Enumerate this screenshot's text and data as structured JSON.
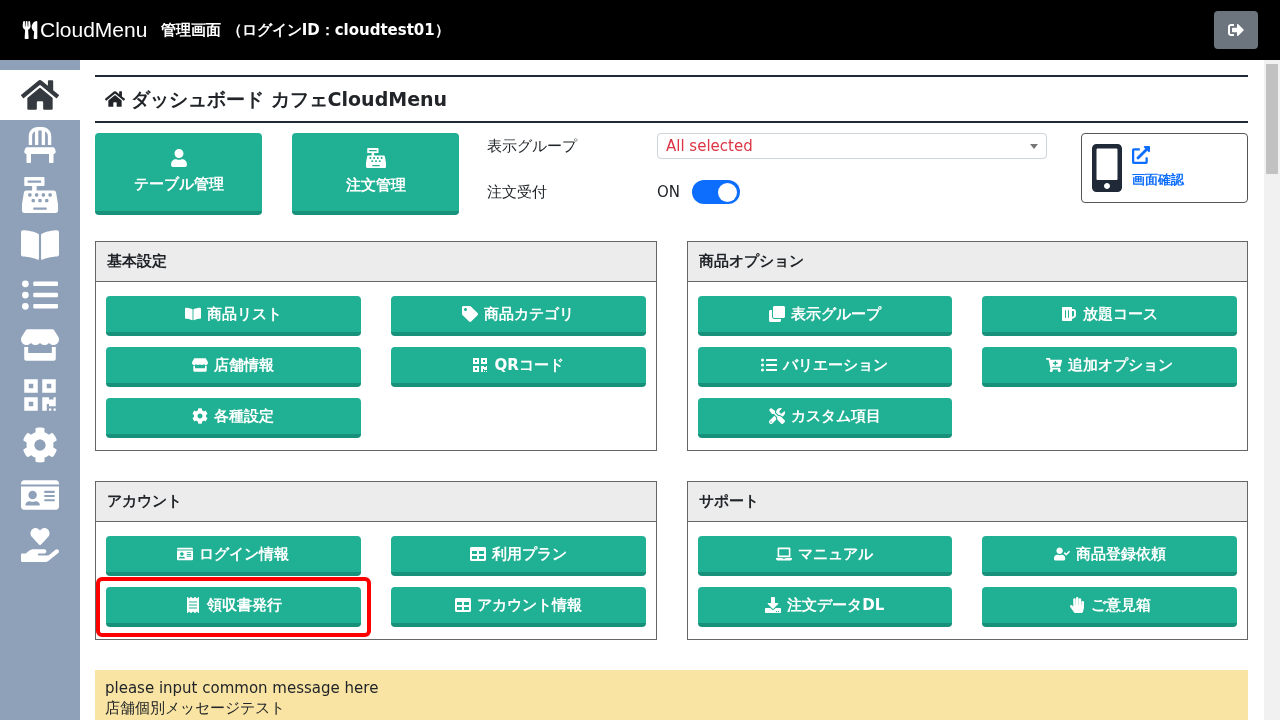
{
  "header": {
    "brand": "CloudMenu",
    "title": "管理画面 （ログインID：cloudtest01）"
  },
  "sidebar": {
    "items": [
      {
        "selected": true
      },
      {
        "selected": false
      },
      {
        "selected": false
      },
      {
        "selected": false
      },
      {
        "selected": false
      },
      {
        "selected": false
      },
      {
        "selected": false
      },
      {
        "selected": false
      },
      {
        "selected": false
      },
      {
        "selected": false
      }
    ]
  },
  "page_title": "ダッシュボード カフェCloudMenu",
  "quick_buttons": [
    {
      "label": "テーブル管理"
    },
    {
      "label": "注文管理"
    }
  ],
  "display_group": {
    "label": "表示グループ",
    "value": "All selected"
  },
  "order_accept": {
    "label": "注文受付",
    "state_text": "ON",
    "on": true
  },
  "preview_button": {
    "label": "画面確認"
  },
  "sections": [
    {
      "title": "基本設定",
      "buttons": [
        {
          "label": "商品リスト",
          "highlighted": false
        },
        {
          "label": "商品カテゴリ",
          "highlighted": false
        },
        {
          "label": "店舗情報",
          "highlighted": false
        },
        {
          "label": "QRコード",
          "highlighted": false
        },
        {
          "label": "各種設定",
          "highlighted": false
        }
      ]
    },
    {
      "title": "商品オプション",
      "buttons": [
        {
          "label": "表示グループ",
          "highlighted": false
        },
        {
          "label": "放題コース",
          "highlighted": false
        },
        {
          "label": "バリエーション",
          "highlighted": false
        },
        {
          "label": "追加オプション",
          "highlighted": false
        },
        {
          "label": "カスタム項目",
          "highlighted": false
        }
      ]
    },
    {
      "title": "アカウント",
      "buttons": [
        {
          "label": "ログイン情報",
          "highlighted": false
        },
        {
          "label": "利用プラン",
          "highlighted": false
        },
        {
          "label": "領収書発行",
          "highlighted": true
        },
        {
          "label": "アカウント情報",
          "highlighted": false
        }
      ]
    },
    {
      "title": "サポート",
      "buttons": [
        {
          "label": "マニュアル",
          "highlighted": false
        },
        {
          "label": "商品登録依頼",
          "highlighted": false
        },
        {
          "label": "注文データDL",
          "highlighted": false
        },
        {
          "label": "ご意見箱",
          "highlighted": false
        }
      ]
    }
  ],
  "message": {
    "lines": [
      "please input common message here",
      "店舗個別メッセージテスト"
    ]
  }
}
